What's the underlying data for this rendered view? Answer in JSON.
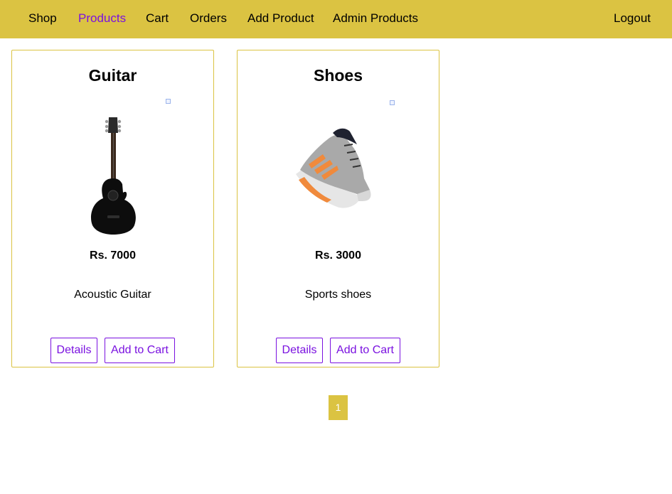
{
  "nav": {
    "items": [
      {
        "label": "Shop"
      },
      {
        "label": "Products"
      },
      {
        "label": "Cart"
      },
      {
        "label": "Orders"
      },
      {
        "label": "Add Product"
      },
      {
        "label": "Admin Products"
      }
    ],
    "active": "Products",
    "logout": "Logout"
  },
  "products": [
    {
      "title": "Guitar",
      "price": "Rs. 7000",
      "description": "Acoustic Guitar",
      "image_icon": "guitar-image",
      "details_label": "Details",
      "add_to_cart_label": "Add to Cart"
    },
    {
      "title": "Shoes",
      "price": "Rs. 3000",
      "description": "Sports shoes",
      "image_icon": "shoe-image",
      "details_label": "Details",
      "add_to_cart_label": "Add to Cart"
    }
  ],
  "pagination": {
    "current": "1"
  },
  "colors": {
    "accent": "#dbc342",
    "link": "#7a11e0"
  }
}
